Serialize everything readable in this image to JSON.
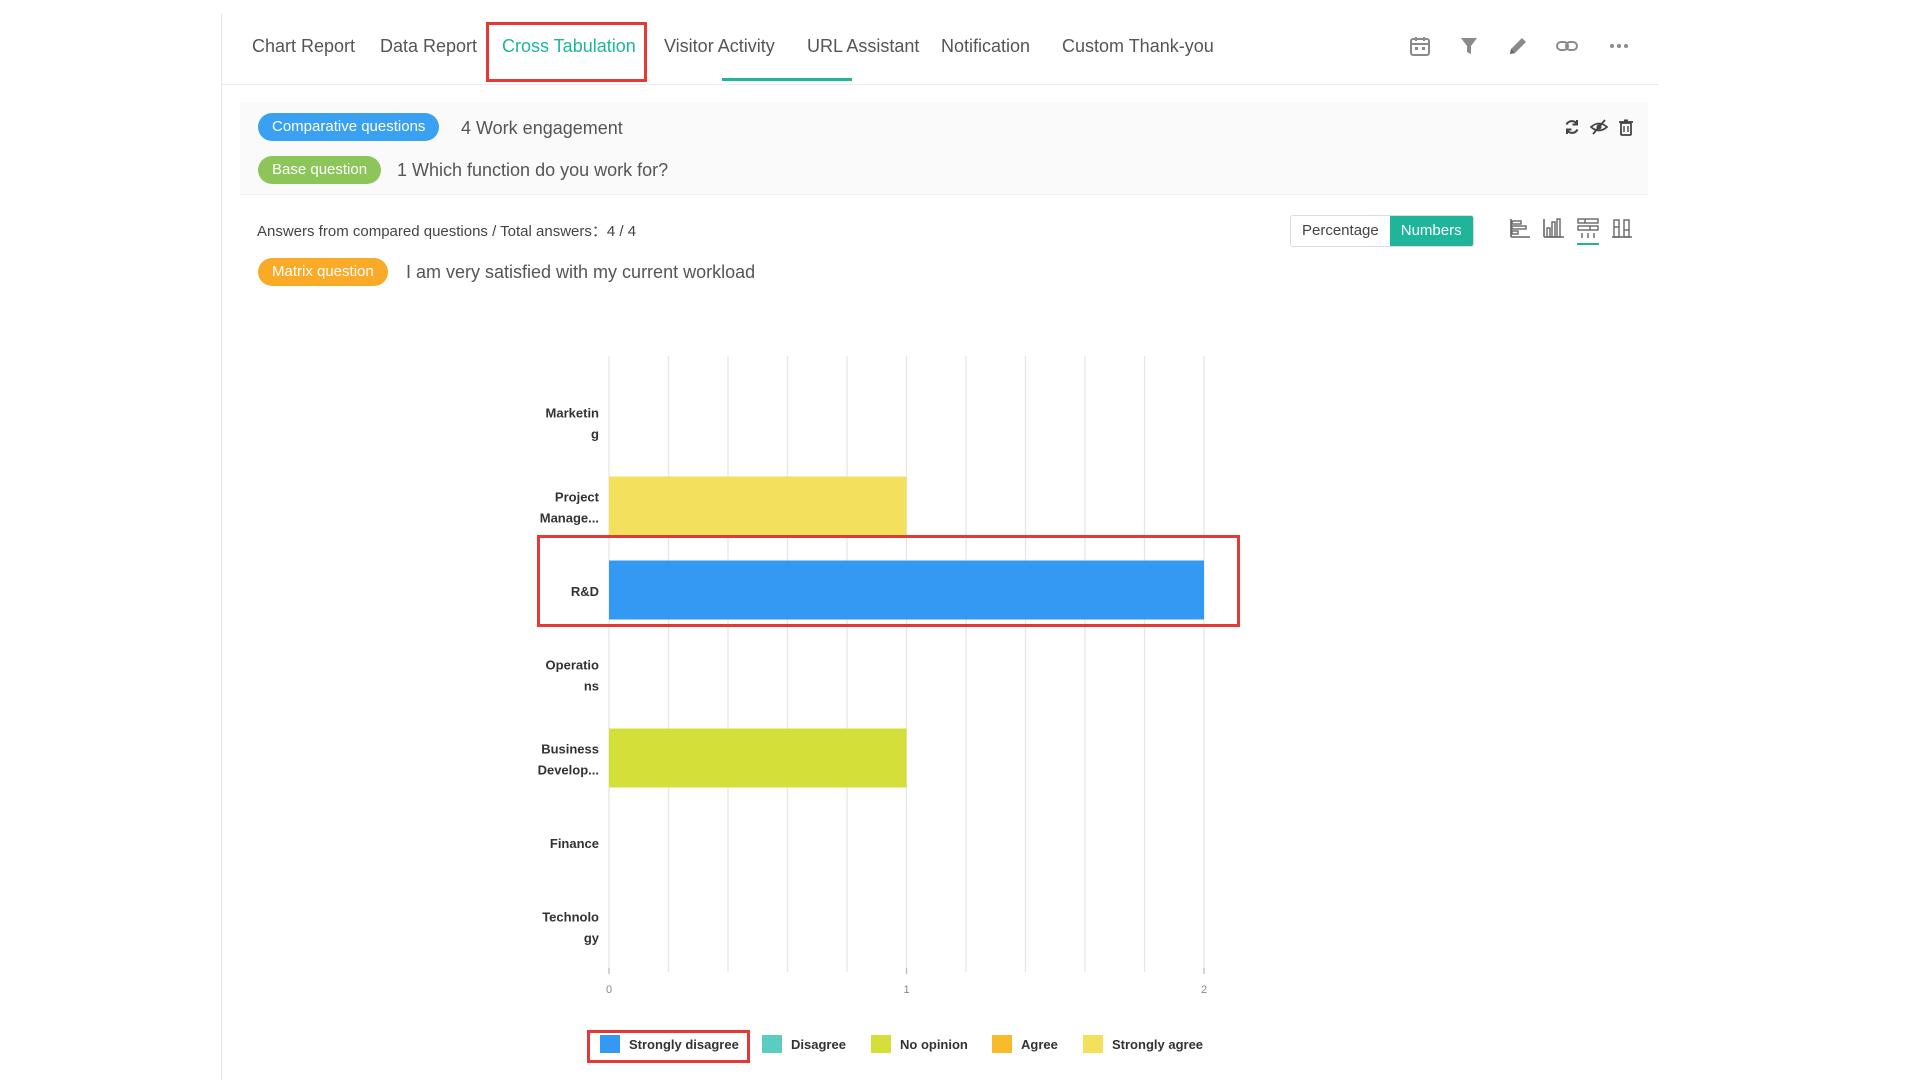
{
  "nav": {
    "tabs": [
      {
        "label": "Chart Report"
      },
      {
        "label": "Data Report"
      },
      {
        "label": "Cross Tabulation"
      },
      {
        "label": "Visitor Activity"
      },
      {
        "label": "URL Assistant"
      },
      {
        "label": "Notification"
      },
      {
        "label": "Custom Thank-you"
      }
    ],
    "active_tab": "Cross Tabulation",
    "icons": [
      "calendar-icon",
      "filter-icon",
      "pencil-icon",
      "link-icon",
      "more-icon"
    ]
  },
  "header": {
    "comparative_label": "Comparative questions",
    "comparative_text": "4 Work engagement",
    "base_label": "Base question",
    "base_text": "1 Which function do you work for?",
    "icons": [
      "refresh-icon",
      "hide-icon",
      "trash-icon"
    ]
  },
  "summary": {
    "answers_text": "Answers from compared questions / Total answers：4 / 4",
    "toggle": [
      "Percentage",
      "Numbers"
    ],
    "toggle_selected": "Numbers",
    "chart_type_icons": [
      "horizontal-bar-icon",
      "vertical-bar-icon",
      "stacked-horizontal-bar-icon",
      "stacked-vertical-bar-icon"
    ]
  },
  "matrix": {
    "label": "Matrix question",
    "text": "I am very satisfied with my current workload"
  },
  "colors": {
    "accent": "#1fb59a",
    "annotation": "#e53935"
  },
  "chart_data": {
    "type": "bar",
    "orientation": "horizontal",
    "stacked": true,
    "categories": [
      "Marketin\ng",
      "Project\nManage...",
      "R&D",
      "Operatio\nns",
      "Business\nDevelop...",
      "Finance",
      "Technolo\ngy"
    ],
    "xticks": [
      "0",
      "1",
      "2"
    ],
    "xlim": [
      0,
      2
    ],
    "grid": true,
    "legend_position": "bottom",
    "series": [
      {
        "name": "Strongly disagree",
        "color": "#3399f3",
        "values": [
          0,
          0,
          2,
          0,
          0,
          0,
          0
        ]
      },
      {
        "name": "Disagree",
        "color": "#5ccbc0",
        "values": [
          0,
          0,
          0,
          0,
          0,
          0,
          0
        ]
      },
      {
        "name": "No opinion",
        "color": "#d5df3a",
        "values": [
          0,
          0,
          0,
          0,
          1,
          0,
          0
        ]
      },
      {
        "name": "Agree",
        "color": "#f9bb2b",
        "values": [
          0,
          0,
          0,
          0,
          0,
          0,
          0
        ]
      },
      {
        "name": "Strongly agree",
        "color": "#f3e05c",
        "values": [
          0,
          1,
          0,
          0,
          0,
          0,
          0
        ]
      }
    ]
  }
}
